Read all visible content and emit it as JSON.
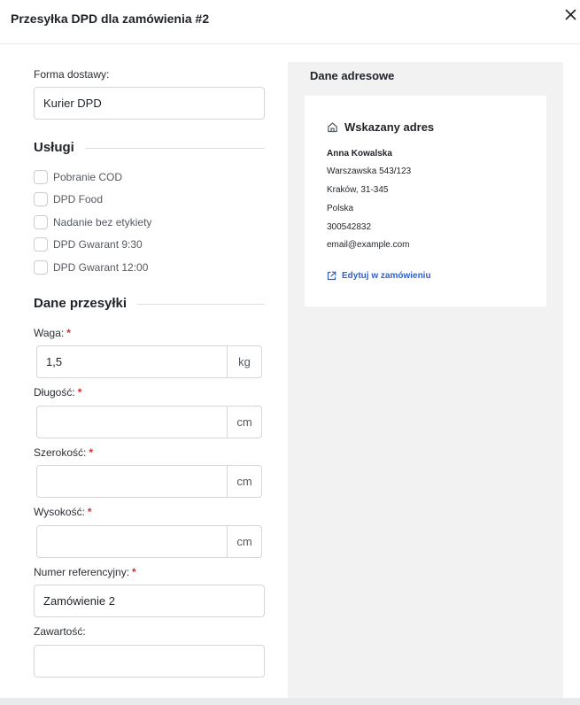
{
  "modal": {
    "title": "Przesyłka DPD dla zamówienia #2"
  },
  "delivery": {
    "label": "Forma dostawy:",
    "value": "Kurier DPD"
  },
  "services": {
    "title": "Usługi",
    "items": [
      {
        "label": "Pobranie COD",
        "checked": false
      },
      {
        "label": "DPD Food",
        "checked": false
      },
      {
        "label": "Nadanie bez etykiety",
        "checked": false
      },
      {
        "label": "DPD Gwarant 9:30",
        "checked": false
      },
      {
        "label": "DPD Gwarant 12:00",
        "checked": false
      }
    ]
  },
  "shipment": {
    "title": "Dane przesyłki",
    "required_mark": "*",
    "weight": {
      "label": "Waga:",
      "value": "1,5",
      "unit": "kg"
    },
    "length": {
      "label": "Długość:",
      "value": "",
      "unit": "cm"
    },
    "width": {
      "label": "Szerokość:",
      "value": "",
      "unit": "cm"
    },
    "height": {
      "label": "Wysokość:",
      "value": "",
      "unit": "cm"
    },
    "reference": {
      "label": "Numer referencyjny:",
      "value": "Zamówienie 2"
    },
    "contents": {
      "label": "Zawartość:",
      "value": ""
    }
  },
  "address": {
    "heading": "Dane adresowe",
    "card_title": "Wskazany adres",
    "name": "Anna Kowalska",
    "street": "Warszawska 543/123",
    "city": "Kraków, 31-345",
    "country": "Polska",
    "phone": "300542832",
    "email": "email@example.com",
    "edit_label": "Edytuj w zamówieniu"
  },
  "icons": {
    "close": "close-icon",
    "home": "home-icon",
    "external_link": "external-link-icon"
  },
  "colors": {
    "accent_link": "#2f5fd0",
    "required": "#d92b2b",
    "panel_bg": "#f2f2f3"
  }
}
